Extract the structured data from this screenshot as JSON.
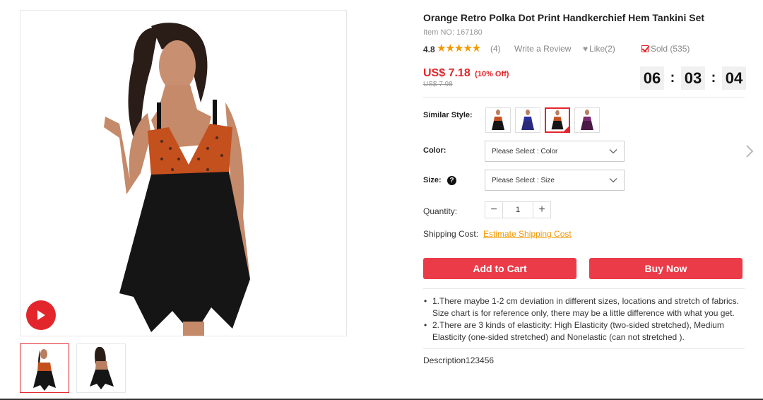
{
  "product": {
    "title": "Orange Retro Polka Dot Print Handkerchief Hem Tankini Set",
    "item_no": "Item NO: 167180",
    "rating_score": "4.8",
    "stars": "★★★★★",
    "rating": 4.8,
    "review_count": "(4)",
    "write_review": "Write a Review",
    "like_label": "Like(2)",
    "sold_label": "Sold (535)"
  },
  "price": {
    "current": "US$ 7.18",
    "discount": "(10% Off)",
    "original": "US$ 7.98"
  },
  "timer": {
    "hours": "06",
    "minutes": "03",
    "seconds": "04",
    "separator": ":"
  },
  "options": {
    "similar_style_label": "Similar Style:",
    "color_label": "Color:",
    "color_placeholder": "Please Select : Color",
    "size_label": "Size:",
    "size_placeholder": "Please Select : Size",
    "quantity_label": "Quantity:",
    "quantity_value": "1",
    "minus": "−",
    "plus": "+",
    "shipping_label": "Shipping Cost:",
    "shipping_link": "Estimate Shipping Cost"
  },
  "actions": {
    "add_to_cart": "Add to Cart",
    "buy_now": "Buy Now"
  },
  "notes": [
    "1.There maybe 1-2 cm deviation in different sizes, locations and stretch of fabrics. Size chart is for reference only, there may be a little difference with what you get.",
    "2.There are 3 kinds of elasticity: High Elasticity (two-sided stretched), Medium Elasticity (one-sided stretched) and Nonelastic (can not stretched )."
  ],
  "description": "Description123456",
  "icons": [
    "play-icon",
    "heart-icon",
    "check-icon",
    "chevron-down-icon",
    "help-icon",
    "chevron-right-icon"
  ],
  "colors": {
    "accent": "#e3262c",
    "button": "#ec3b48",
    "stars": "#f39800",
    "link": "#f39800"
  }
}
